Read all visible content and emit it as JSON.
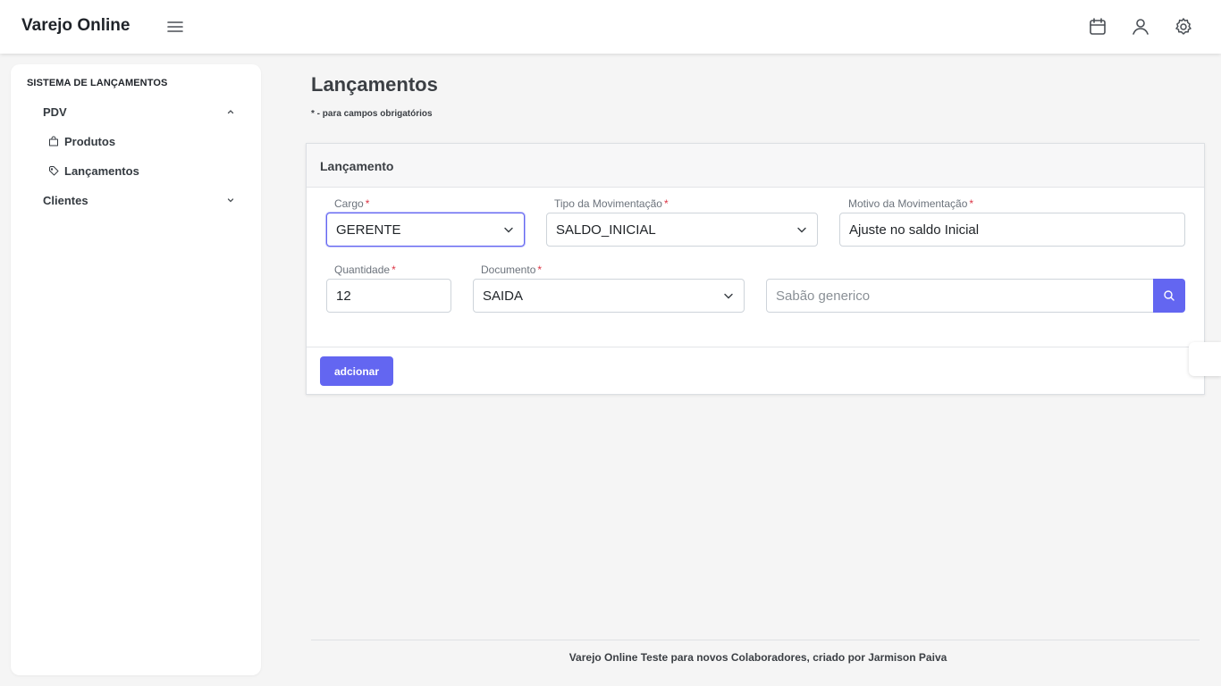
{
  "header": {
    "brand": "Varejo Online"
  },
  "sidebar": {
    "heading": "SISTEMA DE LANÇAMENTOS",
    "groups": [
      {
        "label": "PDV",
        "expanded": true,
        "items": [
          {
            "label": "Produtos",
            "icon": "bag-icon"
          },
          {
            "label": "Lançamentos",
            "icon": "tag-icon"
          }
        ]
      },
      {
        "label": "Clientes",
        "expanded": false,
        "items": []
      }
    ]
  },
  "page": {
    "title": "Lançamentos",
    "note": "* - para campos obrigatórios"
  },
  "form": {
    "card_title": "Lançamento",
    "required_mark": "*",
    "fields": {
      "cargo": {
        "label": "Cargo",
        "value": "GERENTE"
      },
      "tipo": {
        "label": "Tipo da Movimentação",
        "value": "SALDO_INICIAL"
      },
      "motivo": {
        "label": "Motivo da Movimentação",
        "value": "Ajuste no saldo Inicial"
      },
      "quantidade": {
        "label": "Quantidade",
        "value": "12"
      },
      "documento": {
        "label": "Documento",
        "value": "SAIDA"
      },
      "produto": {
        "placeholder": "Sabão generico"
      }
    },
    "submit_label": "adcionar"
  },
  "footer": {
    "text": "Varejo Online Teste para novos Colaboradores, criado por Jarmison Paiva"
  },
  "colors": {
    "accent": "#6366f1",
    "required": "#dc3545",
    "background": "#f5f5f5"
  }
}
